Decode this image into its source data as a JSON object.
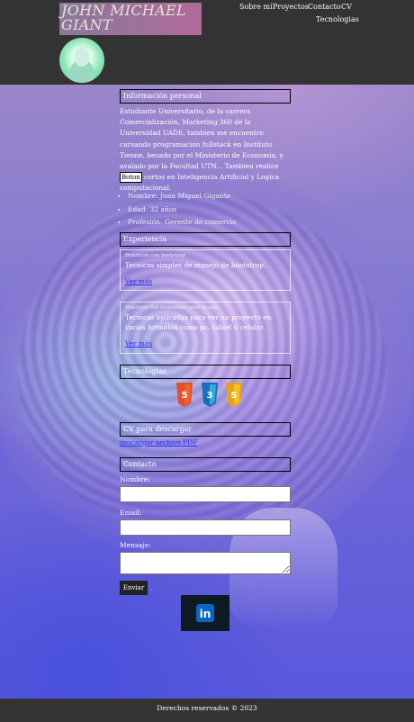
{
  "header": {
    "name": "JOHN MICHAEL GIANT",
    "nav": [
      "Sobre mí",
      "Proyectos",
      "Contacto",
      "CV",
      "Tecnologias"
    ]
  },
  "about": {
    "heading": "Información personal",
    "text": "Estudiante Universitario, de la carrera Comercialización, Marketing 360 de la Universidad UADE, tambien me encuentro cursando programacion fullstack en Instituto Tienne, becado por el Ministerio de Economia, y avalado por la Facultad UTN... Tambien realice cursos cortos en Inteligencia Artificial y Logica computacional.",
    "toggle_label": "Boton",
    "items": [
      "Nombre: Juan Miguel Gigante",
      "Edad: 32 años",
      "Profesión: Gerente de comercio"
    ]
  },
  "experience": {
    "heading": "Experiencia",
    "cards": [
      {
        "title": "Practicas con bootstrap",
        "desc": "Tecnicas simples de manejo de bootstrap.",
        "link": "Ver más"
      },
      {
        "title": "Practicas full responsive web design",
        "desc": "Tecnicas aplicadas para ver un proyecto en varios formatos como pc, tablet o celular.",
        "link": "Ver más"
      }
    ]
  },
  "tech": {
    "heading": "Tecnologias",
    "icons": [
      "html5-icon",
      "css3-icon",
      "javascript-icon"
    ]
  },
  "cv": {
    "heading": "CV para descargar",
    "link": "descargar archivo PDF"
  },
  "contact": {
    "heading": "Contacto",
    "name_label": "Nombre:",
    "email_label": "Email:",
    "message_label": "Mensaje:",
    "send_label": "Enviar",
    "send_extra": "ꞈ",
    "social_icon": "linkedin-icon"
  },
  "footer": {
    "text": "Derechos reservados © 2023"
  },
  "colors": {
    "header_bg": "#333333",
    "title_bg": "#9a6f9a",
    "link": "#2a2aff",
    "accent": "#e44d26"
  }
}
